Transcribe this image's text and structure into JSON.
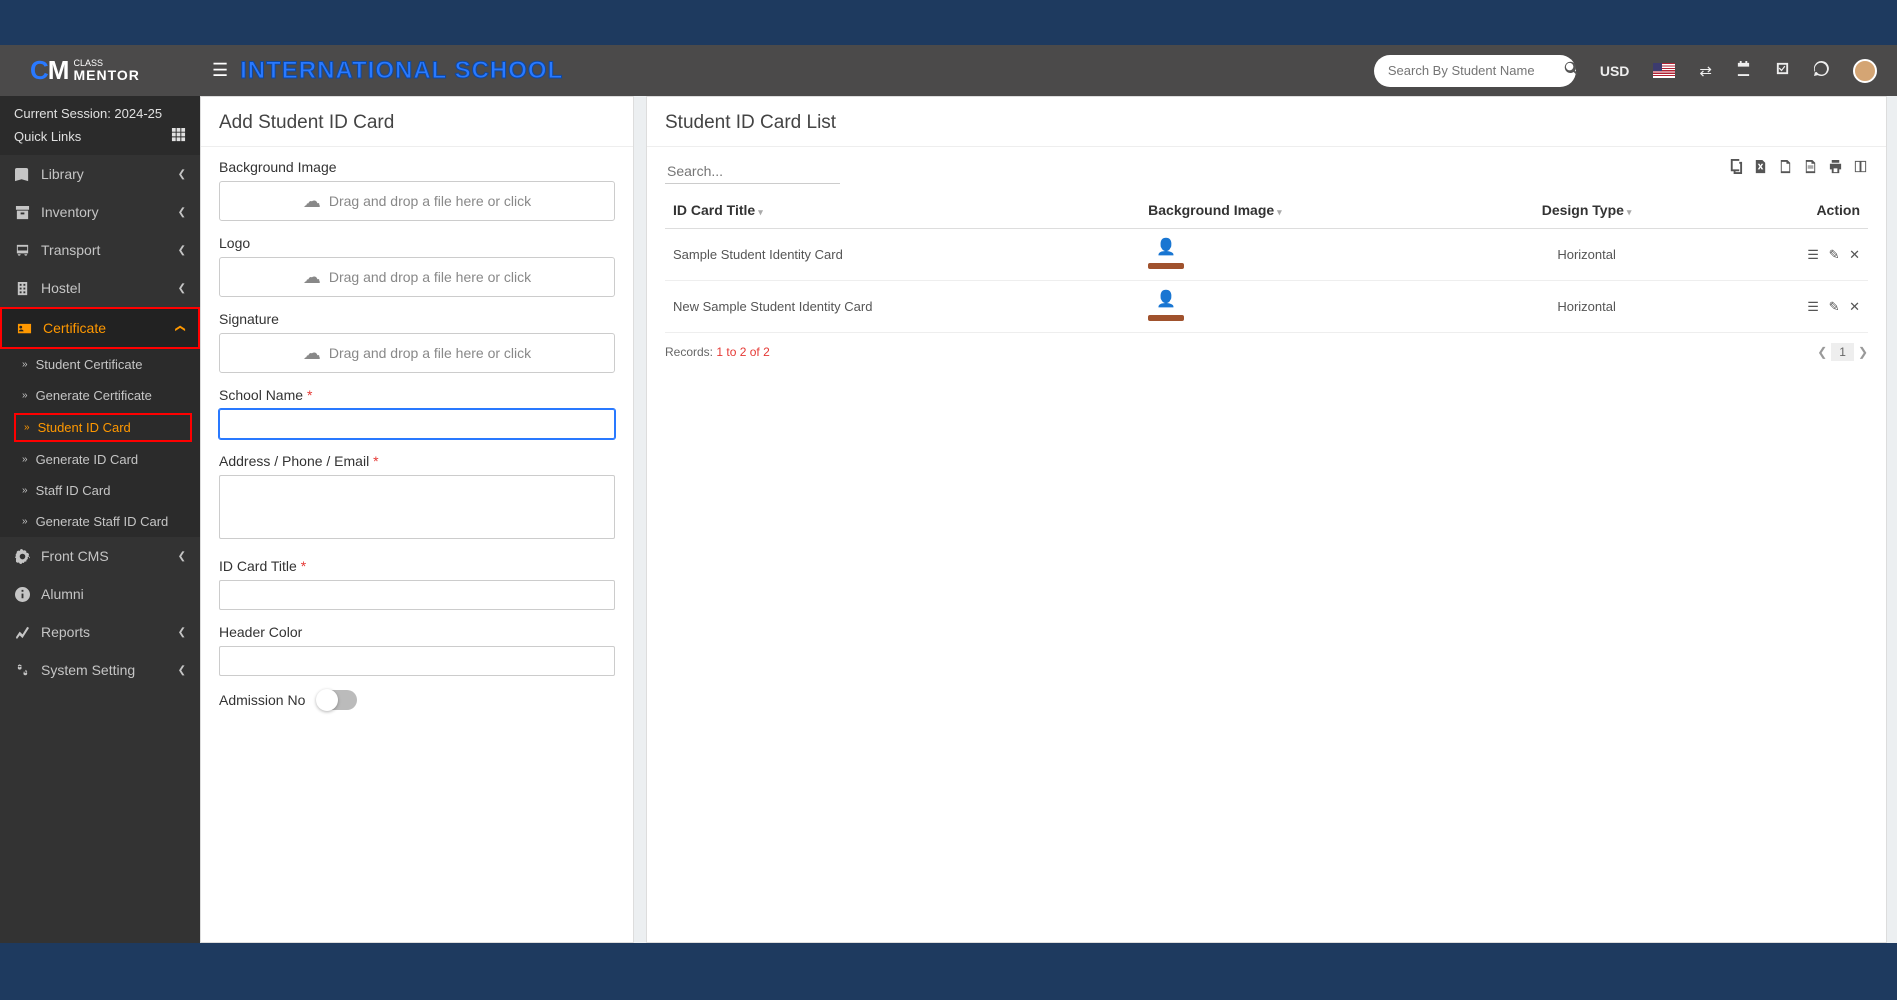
{
  "header": {
    "school": "INTERNATIONAL SCHOOL",
    "search_placeholder": "Search By Student Name",
    "currency": "USD"
  },
  "sidebar": {
    "session": "Current Session: 2024-25",
    "quick_links": "Quick Links",
    "items": [
      {
        "icon": "book",
        "label": "Library"
      },
      {
        "icon": "box",
        "label": "Inventory"
      },
      {
        "icon": "bus",
        "label": "Transport"
      },
      {
        "icon": "building",
        "label": "Hostel"
      },
      {
        "icon": "idcard",
        "label": "Certificate"
      },
      {
        "icon": "gear",
        "label": "Front CMS"
      },
      {
        "icon": "info",
        "label": "Alumni"
      },
      {
        "icon": "chart",
        "label": "Reports"
      },
      {
        "icon": "cogs",
        "label": "System Setting"
      }
    ],
    "cert_sub": [
      "Student Certificate",
      "Generate Certificate",
      "Student ID Card",
      "Generate ID Card",
      "Staff ID Card",
      "Generate Staff ID Card"
    ]
  },
  "form": {
    "title": "Add Student ID Card",
    "bg_label": "Background Image",
    "logo_label": "Logo",
    "sig_label": "Signature",
    "drop_text": "Drag and drop a file here or click",
    "school_name_label": "School Name",
    "address_label": "Address / Phone / Email",
    "id_title_label": "ID Card Title",
    "header_color_label": "Header Color",
    "admission_label": "Admission No"
  },
  "list": {
    "title": "Student ID Card List",
    "search_placeholder": "Search...",
    "cols": {
      "title": "ID Card Title",
      "image": "Background Image",
      "design": "Design Type",
      "action": "Action"
    },
    "rows": [
      {
        "title": "Sample Student Identity Card",
        "design": "Horizontal"
      },
      {
        "title": "New Sample Student Identity Card",
        "design": "Horizontal"
      }
    ],
    "records_label": "Records:",
    "records_range": "1 to 2 of 2",
    "page": "1"
  }
}
